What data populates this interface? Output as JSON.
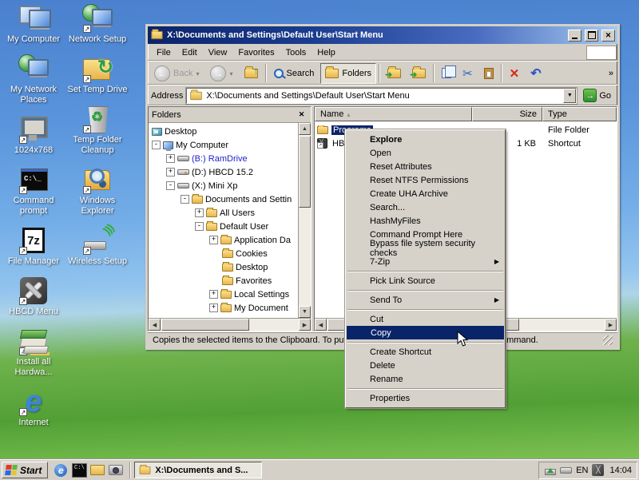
{
  "colors": {
    "selection": "#0a246a",
    "titlebar_gradient_start": "#0a246a",
    "titlebar_gradient_end": "#a6caf0",
    "chrome": "#d4d0c8",
    "desktop_sky": "#5a95dc",
    "desktop_grass": "#52a035"
  },
  "desktop": {
    "col1": [
      {
        "label": "My Computer",
        "icon": "computer-lg-icon"
      },
      {
        "label": "My Network Places",
        "icon": "network-lg-icon"
      },
      {
        "label": "1024x768",
        "icon": "monitor-lg-icon",
        "sc": true
      },
      {
        "label": "Command prompt",
        "icon": "terminal-lg-icon",
        "sc": true
      },
      {
        "label": "File Manager",
        "icon": "sevenzip-lg-icon",
        "sc": true
      },
      {
        "label": "HBCD Menu",
        "icon": "hbcd-lg-icon",
        "sc": true
      },
      {
        "label": "Install all Hardwa...",
        "icon": "hardware-lg-icon",
        "sc": true
      },
      {
        "label": "Internet",
        "icon": "ie-lg-icon",
        "sc": true
      }
    ],
    "col2": [
      {
        "label": "Network Setup",
        "icon": "network-lg-icon",
        "sc": true
      },
      {
        "label": "Set Temp Drive",
        "icon": "folder-clock-lg-icon",
        "sc": true
      },
      {
        "label": "Temp Folder Cleanup",
        "icon": "trash-lg-icon",
        "sc": true
      },
      {
        "label": "Windows Explorer",
        "icon": "folder-search-lg-icon",
        "sc": true
      },
      {
        "label": "Wireless Setup",
        "icon": "wireless-lg-icon",
        "sc": true
      }
    ]
  },
  "window": {
    "title": "X:\\Documents and Settings\\Default User\\Start Menu",
    "menu_bar": {
      "items": [
        {
          "label": "File"
        },
        {
          "label": "Edit"
        },
        {
          "label": "View"
        },
        {
          "label": "Favorites"
        },
        {
          "label": "Tools"
        },
        {
          "label": "Help"
        }
      ]
    },
    "toolbar": {
      "back_label": "Back",
      "search_label": "Search",
      "folders_label": "Folders",
      "chevron": "»"
    },
    "address_bar": {
      "label": "Address",
      "value": "X:\\Documents and Settings\\Default User\\Start Menu",
      "go_label": "Go"
    },
    "folders_pane": {
      "title": "Folders",
      "tree": [
        {
          "label": "Desktop",
          "level": 0,
          "icon": "desktop-mini-icon"
        },
        {
          "label": "My Computer",
          "level": 0,
          "exp": "-",
          "icon": "computer-mini-icon"
        },
        {
          "label": "(B:) RamDrive",
          "level": 1,
          "exp": "+",
          "icon": "drive-mini-icon",
          "cls": "blue"
        },
        {
          "label": "(D:) HBCD 15.2",
          "level": 1,
          "exp": "+",
          "icon": "cd-drive-mini-icon"
        },
        {
          "label": "(X:) Mini Xp",
          "level": 1,
          "exp": "-",
          "icon": "drive-mini-icon"
        },
        {
          "label": "Documents and Settin",
          "level": 2,
          "exp": "-",
          "icon": "folder-mini-icon"
        },
        {
          "label": "All Users",
          "level": 3,
          "exp": "+",
          "icon": "folder-mini-icon"
        },
        {
          "label": "Default User",
          "level": 3,
          "exp": "-",
          "icon": "folder-mini-icon"
        },
        {
          "label": "Application Da",
          "level": 4,
          "exp": "+",
          "icon": "folder-mini-icon"
        },
        {
          "label": "Cookies",
          "level": 4,
          "ph": true,
          "icon": "folder-mini-icon"
        },
        {
          "label": "Desktop",
          "level": 4,
          "ph": true,
          "icon": "folder-mini-icon"
        },
        {
          "label": "Favorites",
          "level": 4,
          "ph": true,
          "icon": "folder-mini-icon"
        },
        {
          "label": "Local Settings",
          "level": 4,
          "exp": "+",
          "icon": "folder-mini-icon"
        },
        {
          "label": "My Document",
          "level": 4,
          "exp": "+",
          "icon": "folder-mini-icon"
        }
      ]
    },
    "file_list": {
      "columns": {
        "name": "Name",
        "size": "Size",
        "type": "Type"
      },
      "rows": [
        {
          "name": "Programs",
          "size": "",
          "type": "File Folder",
          "icon": "folder-mini-icon",
          "cls": "sel"
        },
        {
          "name": "HBCD",
          "size": "1 KB",
          "type": "Shortcut",
          "icon": "tools-shortcut-icon"
        }
      ]
    },
    "status_bar": {
      "text": "Copies the selected items to the Clipboard. To put them in a new location, use the Paste command."
    }
  },
  "context_menu": {
    "items": [
      {
        "label": "Explore",
        "cls": "bold"
      },
      {
        "label": "Open"
      },
      {
        "label": "Reset Attributes"
      },
      {
        "label": "Reset NTFS Permissions"
      },
      {
        "label": "Create UHA Archive"
      },
      {
        "label": "Search..."
      },
      {
        "label": "HashMyFiles"
      },
      {
        "label": "Command Prompt Here"
      },
      {
        "label": "Bypass file system security checks"
      },
      {
        "label": "7-Zip",
        "cls": "sub"
      },
      {
        "label": "",
        "cls": "sep"
      },
      {
        "label": "Pick Link Source"
      },
      {
        "label": "",
        "cls": "sep"
      },
      {
        "label": "Send To",
        "cls": "sub"
      },
      {
        "label": "",
        "cls": "sep"
      },
      {
        "label": "Cut"
      },
      {
        "label": "Copy",
        "cls": "hl"
      },
      {
        "label": "",
        "cls": "sep"
      },
      {
        "label": "Create Shortcut"
      },
      {
        "label": "Delete"
      },
      {
        "label": "Rename"
      },
      {
        "label": "",
        "cls": "sep"
      },
      {
        "label": "Properties"
      }
    ]
  },
  "taskbar": {
    "start_label": "Start",
    "quick_launch": [
      {
        "icon": "internet-explorer-icon"
      },
      {
        "icon": "command-prompt-icon"
      },
      {
        "icon": "folder-ql-icon"
      },
      {
        "icon": "camera-icon"
      }
    ],
    "task_button": {
      "label": "X:\\Documents and S..."
    },
    "tray": {
      "icons": [
        {
          "icon": "eject-green-icon"
        },
        {
          "icon": "drive-tray-icon"
        }
      ],
      "language": "EN",
      "clock": "14:04"
    }
  }
}
